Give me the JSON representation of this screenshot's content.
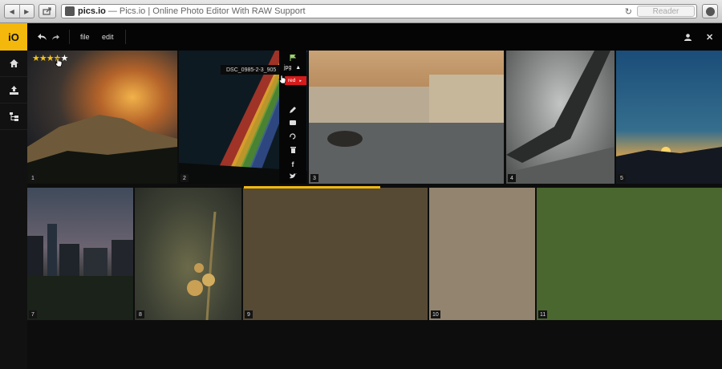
{
  "browser": {
    "host": "pics.io",
    "title": "— Pics.io | Online Photo Editor With RAW Support",
    "reader_label": "Reader"
  },
  "app": {
    "logo": "iO",
    "menu": {
      "file": "file",
      "edit": "edit"
    },
    "sidebar": [
      "home-icon",
      "upload-icon",
      "tree-icon"
    ],
    "colors": {
      "accent": "#f3b80b",
      "red_tag": "#d71b1b"
    }
  },
  "photos": [
    {
      "num": "1",
      "rating": 4
    },
    {
      "num": "2"
    },
    {
      "num": "3"
    },
    {
      "num": "4"
    },
    {
      "num": "5"
    },
    {
      "num": "7"
    },
    {
      "num": "8"
    },
    {
      "num": "9"
    },
    {
      "num": "10"
    },
    {
      "num": "11"
    }
  ],
  "popup": {
    "filename": "DSC_0985-2-3_905",
    "ext": "jpg",
    "tag": "red",
    "tools": [
      "flag-icon",
      "pencil-icon",
      "tag-icon",
      "rotate-icon",
      "trash-icon",
      "facebook-icon",
      "twitter-icon"
    ]
  }
}
